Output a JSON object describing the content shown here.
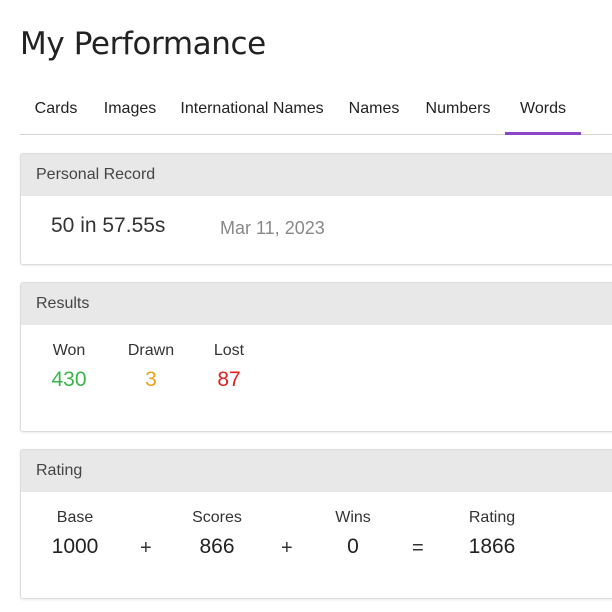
{
  "page": {
    "title": "My Performance"
  },
  "tabs": [
    {
      "label": "Cards",
      "active": false
    },
    {
      "label": "Images",
      "active": false
    },
    {
      "label": "International Names",
      "active": false
    },
    {
      "label": "Names",
      "active": false
    },
    {
      "label": "Numbers",
      "active": false
    },
    {
      "label": "Words",
      "active": true
    }
  ],
  "personal_record": {
    "header": "Personal Record",
    "result": "50 in 57.55s",
    "date": "Mar 11, 2023"
  },
  "results": {
    "header": "Results",
    "won_label": "Won",
    "won_value": "430",
    "drawn_label": "Drawn",
    "drawn_value": "3",
    "lost_label": "Lost",
    "lost_value": "87"
  },
  "rating": {
    "header": "Rating",
    "base_label": "Base",
    "base_value": "1000",
    "plus_1": "+",
    "scores_label": "Scores",
    "scores_value": "866",
    "plus_2": "+",
    "wins_label": "Wins",
    "wins_value": "0",
    "equals": "=",
    "rating_label": "Rating",
    "rating_value": "1866"
  },
  "colors": {
    "accent": "#8e44c9",
    "won": "#3bb54a",
    "drawn": "#f0a020",
    "lost": "#e02020"
  }
}
